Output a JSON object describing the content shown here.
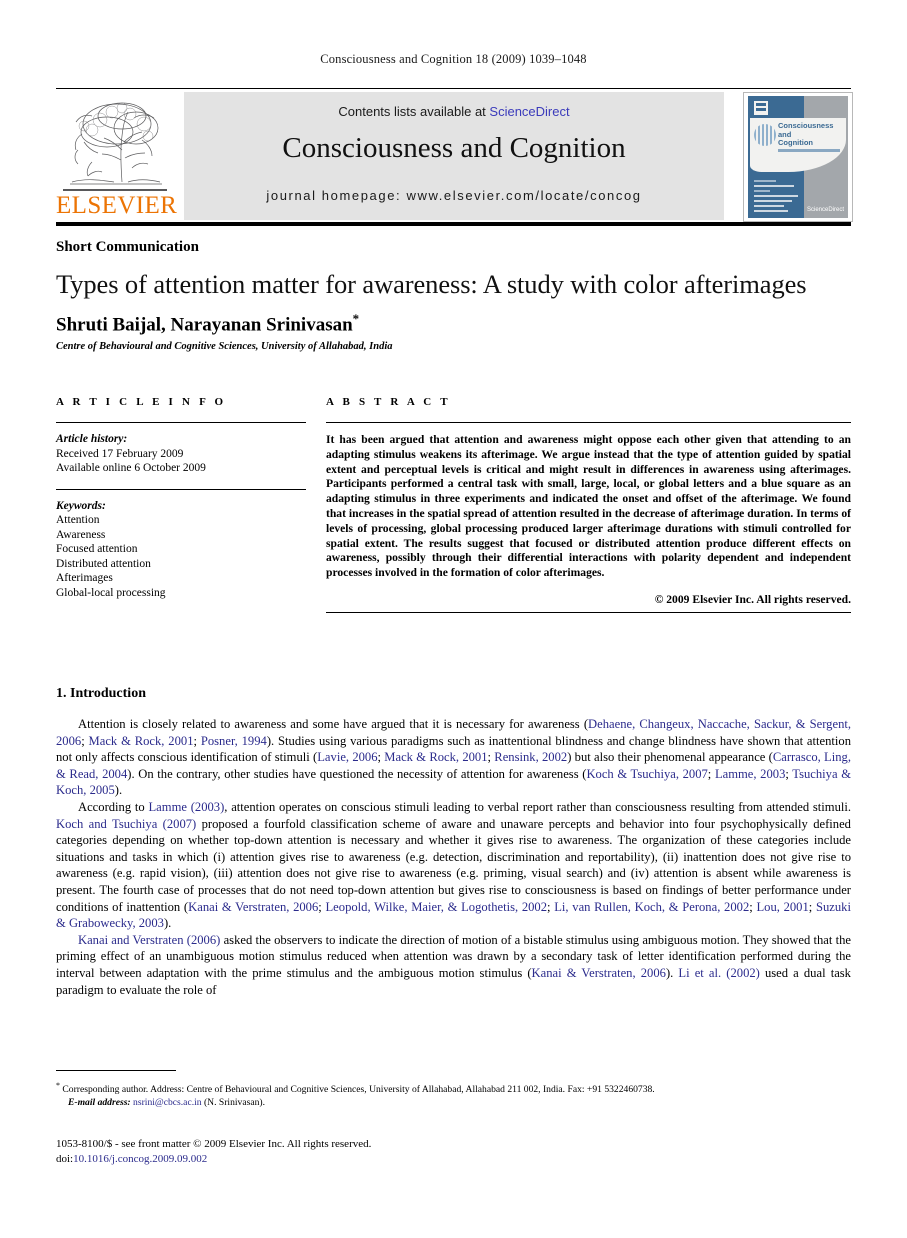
{
  "running_head": "Consciousness and Cognition 18 (2009) 1039–1048",
  "masthead": {
    "publisher_name": "ELSEVIER",
    "contents_prefix": "Contents lists available at ",
    "contents_link": "ScienceDirect",
    "journal_title": "Consciousness and Cognition",
    "homepage": "journal homepage: www.elsevier.com/locate/concog",
    "cover": {
      "title_line1": "Consciousness",
      "title_line2": "and",
      "title_line3": "Cognition",
      "brand": "ScienceDirect"
    }
  },
  "article": {
    "kind": "Short Communication",
    "title": "Types of attention matter for awareness: A study with color afterimages",
    "authors": "Shruti Baijal, Narayanan Srinivasan",
    "corresponding_marker": "*",
    "affiliation": "Centre of Behavioural and Cognitive Sciences, University of Allahabad, India"
  },
  "article_info": {
    "heading": "ARTICLE INFO",
    "history_label": "Article history:",
    "history": [
      "Received 17 February 2009",
      "Available online 6 October 2009"
    ],
    "keywords_label": "Keywords:",
    "keywords": [
      "Attention",
      "Awareness",
      "Focused attention",
      "Distributed attention",
      "Afterimages",
      "Global-local processing"
    ]
  },
  "abstract": {
    "heading": "ABSTRACT",
    "text": "It has been argued that attention and awareness might oppose each other given that attending to an adapting stimulus weakens its afterimage. We argue instead that the type of attention guided by spatial extent and perceptual levels is critical and might result in differences in awareness using afterimages. Participants performed a central task with small, large, local, or global letters and a blue square as an adapting stimulus in three experiments and indicated the onset and offset of the afterimage. We found that increases in the spatial spread of attention resulted in the decrease of afterimage duration. In terms of levels of processing, global processing produced larger afterimage durations with stimuli controlled for spatial extent. The results suggest that focused or distributed attention produce different effects on awareness, possibly through their differential interactions with polarity dependent and independent processes involved in the formation of color afterimages.",
    "copyright": "© 2009 Elsevier Inc. All rights reserved."
  },
  "body": {
    "section_heading": "1. Introduction",
    "paragraphs": [
      [
        {
          "t": "Attention is closely related to awareness and some have argued that it is necessary for awareness ("
        },
        {
          "t": "Dehaene, Changeux, Naccache, Sackur, & Sergent, 2006",
          "ref": true
        },
        {
          "t": "; "
        },
        {
          "t": "Mack & Rock, 2001",
          "ref": true
        },
        {
          "t": "; "
        },
        {
          "t": "Posner, 1994",
          "ref": true
        },
        {
          "t": "). Studies using various paradigms such as inattentional blindness and change blindness have shown that attention not only affects conscious identification of stimuli ("
        },
        {
          "t": "Lavie, 2006",
          "ref": true
        },
        {
          "t": "; "
        },
        {
          "t": "Mack & Rock, 2001",
          "ref": true
        },
        {
          "t": "; "
        },
        {
          "t": "Rensink, 2002",
          "ref": true
        },
        {
          "t": ") but also their phenomenal appearance ("
        },
        {
          "t": "Carrasco, Ling, & Read, 2004",
          "ref": true
        },
        {
          "t": "). On the contrary, other studies have questioned the necessity of attention for awareness ("
        },
        {
          "t": "Koch & Tsuchiya, 2007",
          "ref": true
        },
        {
          "t": "; "
        },
        {
          "t": "Lamme, 2003",
          "ref": true
        },
        {
          "t": "; "
        },
        {
          "t": "Tsuchiya & Koch, 2005",
          "ref": true
        },
        {
          "t": ")."
        }
      ],
      [
        {
          "t": "According to "
        },
        {
          "t": "Lamme (2003)",
          "ref": true
        },
        {
          "t": ", attention operates on conscious stimuli leading to verbal report rather than consciousness resulting from attended stimuli. "
        },
        {
          "t": "Koch and Tsuchiya (2007)",
          "ref": true
        },
        {
          "t": " proposed a fourfold classification scheme of aware and unaware percepts and behavior into four psychophysically defined categories depending on whether top-down attention is necessary and whether it gives rise to awareness. The organization of these categories include situations and tasks in which (i) attention gives rise to awareness (e.g. detection, discrimination and reportability), (ii) inattention does not give rise to awareness (e.g. rapid vision), (iii) attention does not give rise to awareness (e.g. priming, visual search) and (iv) attention is absent while awareness is present. The fourth case of processes that do not need top-down attention but gives rise to consciousness is based on findings of better performance under conditions of inattention ("
        },
        {
          "t": "Kanai & Verstraten, 2006",
          "ref": true
        },
        {
          "t": "; "
        },
        {
          "t": "Leopold, Wilke, Maier, & Logothetis, 2002",
          "ref": true
        },
        {
          "t": "; "
        },
        {
          "t": "Li, van Rullen, Koch, & Perona, 2002",
          "ref": true
        },
        {
          "t": "; "
        },
        {
          "t": "Lou, 2001",
          "ref": true
        },
        {
          "t": "; "
        },
        {
          "t": "Suzuki & Grabowecky, 2003",
          "ref": true
        },
        {
          "t": ")."
        }
      ],
      [
        {
          "t": "Kanai and Verstraten (2006)",
          "ref": true
        },
        {
          "t": " asked the observers to indicate the direction of motion of a bistable stimulus using ambiguous motion. They showed that the priming effect of an unambiguous motion stimulus reduced when attention was drawn by a secondary task of letter identification performed during the interval between adaptation with the prime stimulus and the ambiguous motion stimulus ("
        },
        {
          "t": "Kanai & Verstraten, 2006",
          "ref": true
        },
        {
          "t": "). "
        },
        {
          "t": "Li et al. (2002)",
          "ref": true
        },
        {
          "t": " used a dual task paradigm to evaluate the role of"
        }
      ]
    ]
  },
  "footnote": {
    "marker": "*",
    "line1": "Corresponding author. Address: Centre of Behavioural and Cognitive Sciences, University of Allahabad, Allahabad 211 002, India. Fax: +91 5322460738.",
    "email_label": "E-mail address:",
    "email": "nsrini@cbcs.ac.in",
    "email_suffix": "(N. Srinivasan)."
  },
  "colophon": {
    "line1": "1053-8100/$ - see front matter © 2009 Elsevier Inc. All rights reserved.",
    "doi_label": "doi:",
    "doi": "10.1016/j.concog.2009.09.002"
  },
  "colors": {
    "link": "#2b2b8c",
    "elsevier_orange": "#ec7404",
    "banner_grey": "#e3e3e3",
    "cover_blue": "#3b6a93"
  }
}
